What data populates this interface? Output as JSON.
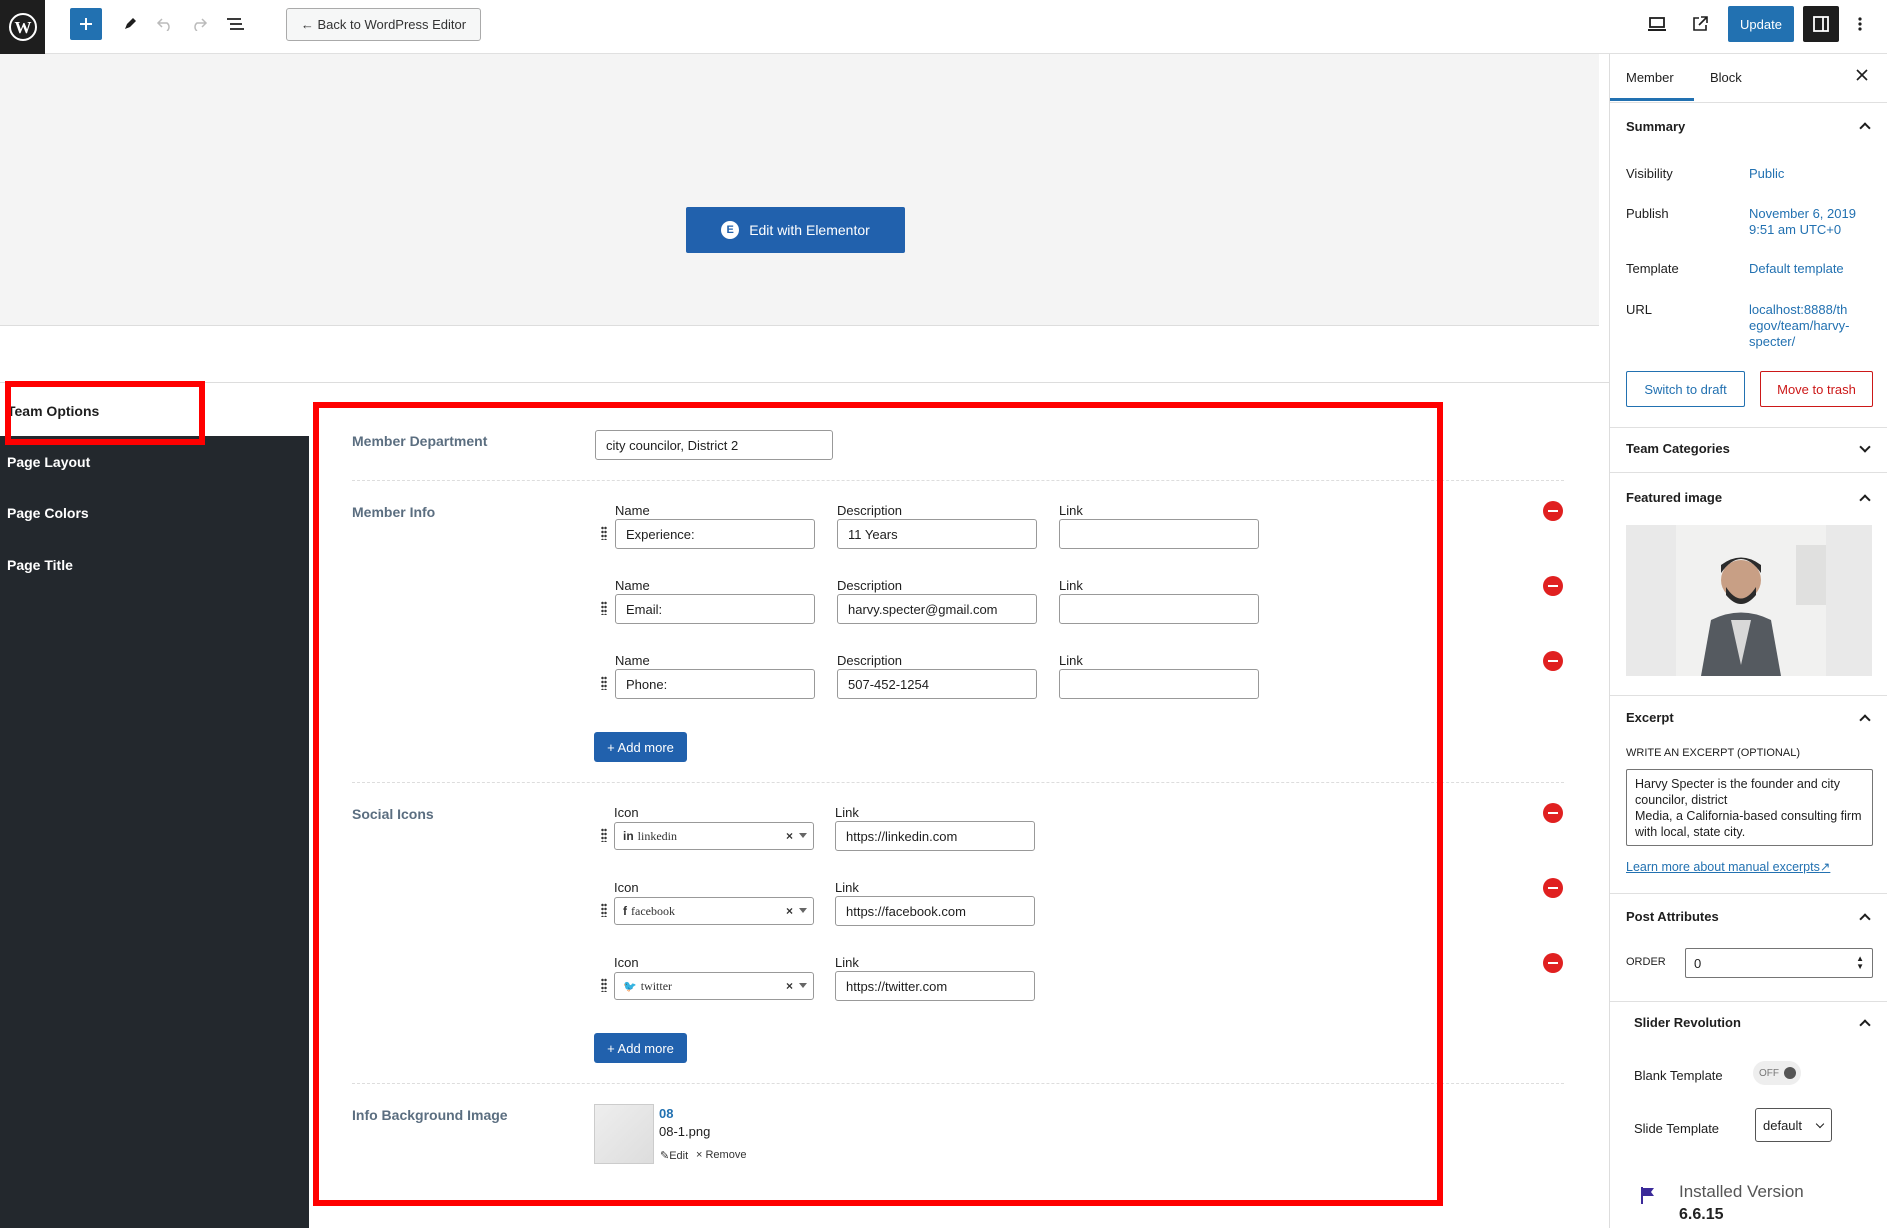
{
  "topbar": {
    "back_label": "← Back to WordPress Editor",
    "update_label": "Update"
  },
  "canvas": {
    "elementor_label": "Edit with Elementor"
  },
  "options_nav": {
    "items": [
      "Team Options",
      "Page Layout",
      "Page Colors",
      "Page Title"
    ]
  },
  "team_options": {
    "department": {
      "label": "Member Department",
      "value": "city councilor, District 2"
    },
    "member_info": {
      "label": "Member Info",
      "col_name": "Name",
      "col_description": "Description",
      "col_link": "Link",
      "rows": [
        {
          "name": "Experience:",
          "description": "11 Years",
          "link": ""
        },
        {
          "name": "Email:",
          "description": "harvy.specter@gmail.com",
          "link": ""
        },
        {
          "name": "Phone:",
          "description": "507-452-1254",
          "link": ""
        }
      ],
      "add_label": "+ Add more"
    },
    "social_icons": {
      "label": "Social Icons",
      "col_icon": "Icon",
      "col_link": "Link",
      "rows": [
        {
          "icon_glyph": "in",
          "icon": "linkedin",
          "link": "https://linkedin.com"
        },
        {
          "icon_glyph": "f",
          "icon": "facebook",
          "link": "https://facebook.com"
        },
        {
          "icon_glyph": "🐦",
          "icon": "twitter",
          "link": "https://twitter.com"
        }
      ],
      "add_label": "+ Add more"
    },
    "info_bg": {
      "label": "Info Background Image",
      "title": "08",
      "filename": "08-1.png",
      "edit_label": "Edit",
      "remove_label": "× Remove"
    }
  },
  "sidebar": {
    "tab_member": "Member",
    "tab_block": "Block",
    "summary": {
      "title": "Summary",
      "visibility_key": "Visibility",
      "visibility_val": "Public",
      "publish_key": "Publish",
      "publish_val_1": "November 6, 2019",
      "publish_val_2": "9:51 am UTC+0",
      "template_key": "Template",
      "template_val": "Default template",
      "url_key": "URL",
      "url_val_1": "localhost:8888/th",
      "url_val_2": "egov/team/harvy-",
      "url_val_3": "specter/",
      "switch_draft": "Switch to draft",
      "move_trash": "Move to trash"
    },
    "team_categories": "Team Categories",
    "featured_image": "Featured image",
    "excerpt": {
      "title": "Excerpt",
      "sub": "WRITE AN EXCERPT (OPTIONAL)",
      "text": "Harvy Specter is the founder and city councilor, district\nMedia, a California-based consulting firm with local, state city.",
      "learn_more": "Learn more about manual excerpts"
    },
    "post_attributes": {
      "title": "Post Attributes",
      "order_label": "ORDER",
      "order_value": "0"
    },
    "slider_revolution": {
      "title": "Slider Revolution",
      "blank_template": "Blank Template",
      "toggle": "OFF",
      "slide_template": "Slide Template",
      "slide_value": "default",
      "installed": "Installed Version",
      "version": "6.6.15"
    }
  },
  "colors": {
    "accent": "#2271b1",
    "elementor": "#2161ad",
    "nav_bg": "#23282d",
    "highlight": "#ff0000",
    "remove": "#e02020"
  }
}
